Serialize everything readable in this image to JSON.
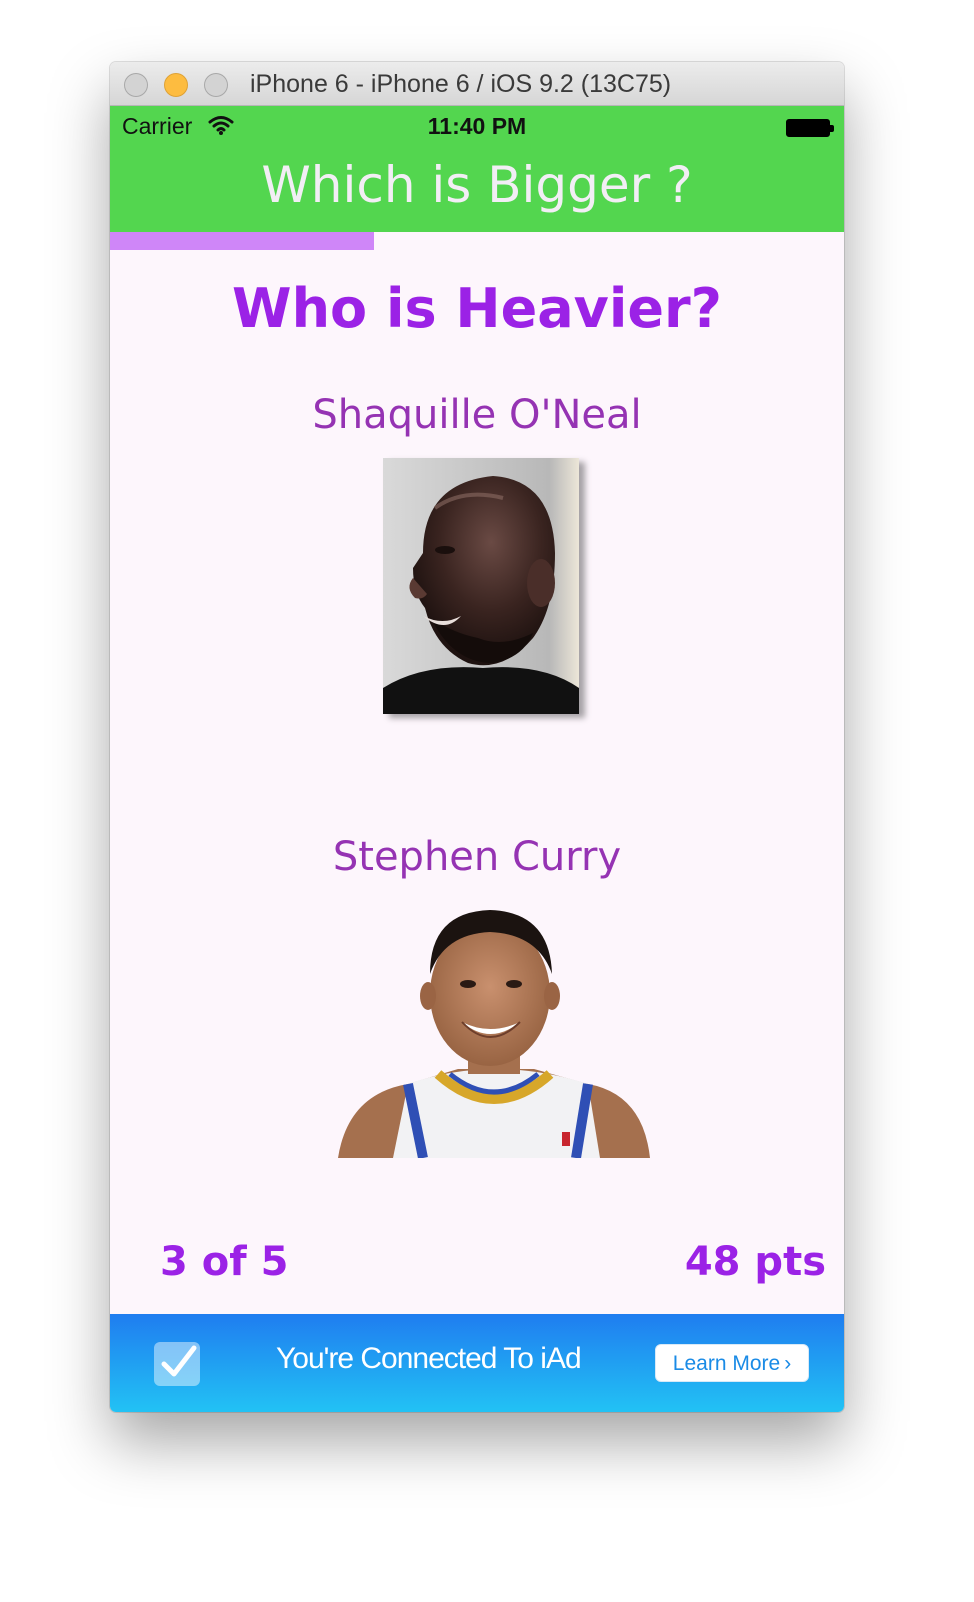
{
  "window": {
    "title": "iPhone 6 - iPhone 6 / iOS 9.2 (13C75)"
  },
  "status_bar": {
    "carrier": "Carrier",
    "time": "11:40 PM"
  },
  "app": {
    "title": "Which is Bigger ?",
    "progress_fraction": 0.36,
    "question": "Who is Heavier?",
    "option_one": {
      "name": "Shaquille O'Neal"
    },
    "option_two": {
      "name": "Stephen Curry"
    },
    "round": "3 of 5",
    "score": "48 pts"
  },
  "ad": {
    "text": "You're Connected To iAd",
    "button_label": "Learn More",
    "button_chevron": "›"
  },
  "colors": {
    "nav_green": "#53d64f",
    "accent_purple": "#9b22e6",
    "name_purple": "#9533b3",
    "progress": "#cf86f8",
    "background": "#fdf6fc",
    "ad_blue": "#1f7df0"
  },
  "icons": [
    "close-light",
    "minimize-light",
    "zoom-light",
    "wifi-icon",
    "battery-icon",
    "checkmark-icon"
  ]
}
